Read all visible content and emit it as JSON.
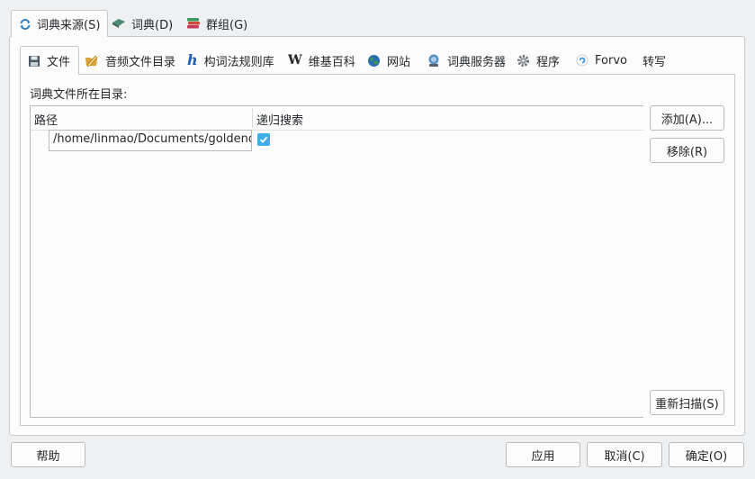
{
  "top_tabs": [
    {
      "label": "词典来源(S)",
      "icon": "refresh-icon"
    },
    {
      "label": "词典(D)",
      "icon": "book-icon"
    },
    {
      "label": "群组(G)",
      "icon": "books-stack-icon"
    }
  ],
  "inner_tabs": [
    {
      "label": "文件",
      "icon": "floppy-icon"
    },
    {
      "label": "音频文件目录",
      "icon": "pencil-folder-icon"
    },
    {
      "label": "构词法规则库",
      "icon": "hunspell-h-icon"
    },
    {
      "label": "维基百科",
      "icon": "wikipedia-w-icon"
    },
    {
      "label": "网站",
      "icon": "globe-icon"
    },
    {
      "label": "词典服务器",
      "icon": "network-server-icon"
    },
    {
      "label": "程序",
      "icon": "gear-icon"
    },
    {
      "label": "Forvo",
      "icon": "forvo-icon"
    },
    {
      "label": "转写",
      "icon": ""
    }
  ],
  "files_panel": {
    "dir_label": "词典文件所在目录:",
    "columns": [
      "路径",
      "递归搜索"
    ],
    "rows": [
      {
        "path": "/home/linmao/Documents/goldendict",
        "recursive": true
      }
    ],
    "buttons": {
      "add": "添加(A)...",
      "remove": "移除(R)",
      "rescan": "重新扫描(S)"
    }
  },
  "footer": {
    "help": "帮助",
    "apply": "应用",
    "cancel": "取消(C)",
    "ok": "确定(O)"
  },
  "colors": {
    "accent": "#3daee9",
    "background": "#eff0f1",
    "panel": "#fcfcfc"
  }
}
